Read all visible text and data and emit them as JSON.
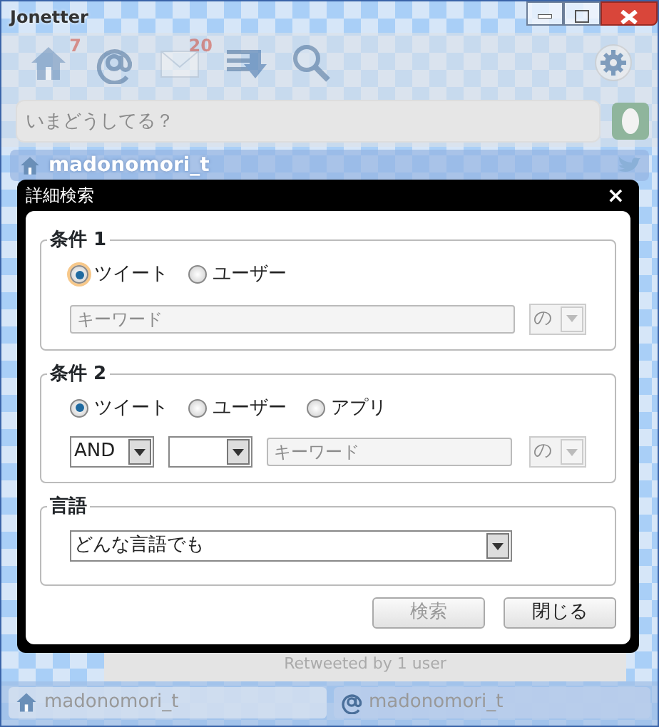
{
  "window": {
    "title": "Jonetter"
  },
  "toolbar": [
    {
      "kind": "home",
      "badge": "7"
    },
    {
      "kind": "mention"
    },
    {
      "kind": "mail",
      "badge": "20"
    },
    {
      "kind": "list"
    },
    {
      "kind": "search"
    }
  ],
  "status_field": {
    "placeholder": "いまどうしてる？"
  },
  "account_header": {
    "name": "madonomori_t"
  },
  "timeline": {
    "retweet_note": "Retweeted by 1 user"
  },
  "dialog": {
    "title": "詳細検索",
    "close_glyph": "×",
    "condition_1": {
      "legend": "条件 1",
      "options": [
        {
          "label": "ツイート",
          "selected": true
        },
        {
          "label": "ユーザー",
          "selected": false
        }
      ],
      "keyword": {
        "placeholder": "キーワード"
      },
      "suffix": {
        "value": "の",
        "disabled": true
      }
    },
    "condition_2": {
      "legend": "条件 2",
      "options": [
        {
          "label": "ツイート",
          "selected": true
        },
        {
          "label": "ユーザー",
          "selected": false
        },
        {
          "label": "アプリ",
          "selected": false
        }
      ],
      "operator": "AND",
      "keyword": {
        "placeholder": "キーワード"
      },
      "suffix": {
        "value": "の",
        "disabled": true
      }
    },
    "language": {
      "legend": "言語",
      "value": "どんな言語でも"
    },
    "buttons": [
      {
        "label": "検索",
        "disabled": true
      },
      {
        "label": "閉じる",
        "disabled": false
      }
    ]
  },
  "bottom_tabs": [
    {
      "kind": "home",
      "label": "madonomori_t"
    },
    {
      "kind": "mention",
      "label": "madonomori_t"
    }
  ]
}
